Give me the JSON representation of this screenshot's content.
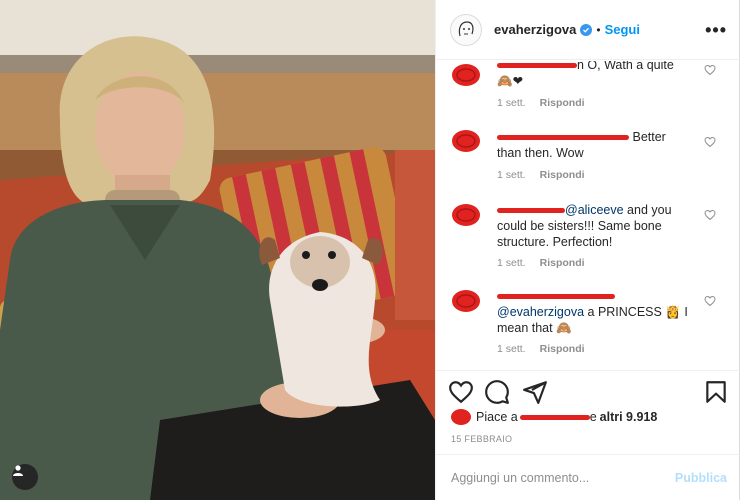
{
  "header": {
    "username": "evaherzigova",
    "separator": "•",
    "follow_label": "Segui",
    "more_label": "•••"
  },
  "comments": [
    {
      "text_visible": "n O, Wath a quite",
      "emoji": "🙈❤",
      "time": "1 sett.",
      "reply_label": "Rispondi"
    },
    {
      "text_suffix": "Better",
      "text_line2": "than then. Wow",
      "time": "1 sett.",
      "reply_label": "Rispondi"
    },
    {
      "mention": "@aliceeve",
      "text": " and you could be sisters!!! Same bone structure. Perfection!",
      "time": "1 sett.",
      "reply_label": "Rispondi"
    },
    {
      "mention": "@evaherzigova",
      "text": " a PRINCESS 👸 I mean that 🙈",
      "time": "1 sett.",
      "reply_label": "Rispondi"
    }
  ],
  "likes": {
    "prefix": "Piace a",
    "middle": " e ",
    "count_label": "altri 9.918"
  },
  "date": "15 FEBBRAIO",
  "add_comment": {
    "placeholder": "Aggiungi un commento...",
    "post_label": "Pubblica"
  },
  "colors": {
    "accent": "#0095f6",
    "redaction": "#e0231f",
    "muted": "#8e8e8e"
  },
  "icons": [
    "heart-icon",
    "comment-icon",
    "share-icon",
    "bookmark-icon",
    "verified-icon",
    "tag-person-icon",
    "more-options-icon"
  ]
}
